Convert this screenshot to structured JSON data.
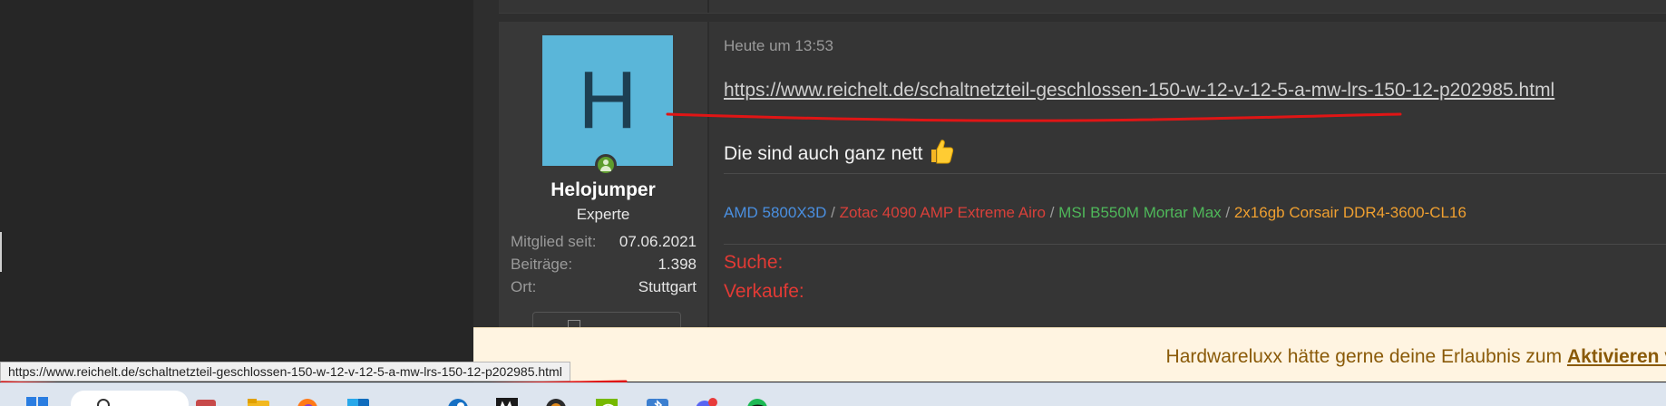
{
  "post": {
    "timestamp": "Heute um 13:53",
    "link": "https://www.reichelt.de/schaltnetzteil-geschlossen-150-w-12-v-12-5-a-mw-lrs-150-12-p202985.html",
    "message": "Die sind auch ganz nett"
  },
  "user": {
    "avatar_letter": "H",
    "name": "Helojumper",
    "rank": "Experte",
    "stats": [
      {
        "label": "Mitglied seit:",
        "value": "07.06.2021"
      },
      {
        "label": "Beiträge:",
        "value": "1.398"
      },
      {
        "label": "Ort:",
        "value": "Stuttgart"
      }
    ]
  },
  "signature": {
    "parts": [
      {
        "text": "AMD 5800X3D",
        "color": "#4a8fe0"
      },
      {
        "text": " / ",
        "color": "#9a9a9a"
      },
      {
        "text": "Zotac 4090 AMP Extreme Airo",
        "color": "#d9403a"
      },
      {
        "text": " / ",
        "color": "#9a9a9a"
      },
      {
        "text": "MSI B550M Mortar Max",
        "color": "#4fb85a"
      },
      {
        "text": " / ",
        "color": "#9a9a9a"
      },
      {
        "text": "2x16gb Corsair DDR4-3600-CL16",
        "color": "#f0a030"
      }
    ],
    "search_label": "Suche:",
    "sell_label": "Verkaufe:"
  },
  "consent": {
    "text": "Hardwareluxx hätte gerne deine Erlaubnis zum ",
    "link_text": "Aktivieren v"
  },
  "status_url": "https://www.reichelt.de/schaltnetzteil-geschlossen-150-w-12-v-12-5-a-mw-lrs-150-12-p202985.html",
  "colors": {
    "accent_blue": "#4a8fe0",
    "accent_red": "#e23a35",
    "avatar_bg": "#5ab6d9",
    "online_green": "#5e9c2e",
    "annotation_red": "#e01515"
  },
  "icons": {
    "thumb": "thumbs-up-emoji",
    "online": "online-status-icon",
    "taskbar": [
      "windows-start-icon",
      "search-icon",
      "task-view-icon",
      "file-explorer-icon",
      "firefox-icon",
      "outlook-icon",
      "steam-icon",
      "msi-afterburner-icon",
      "obs-icon",
      "nvidia-icon",
      "bluetooth-icon",
      "discord-icon",
      "spotify-icon"
    ]
  }
}
